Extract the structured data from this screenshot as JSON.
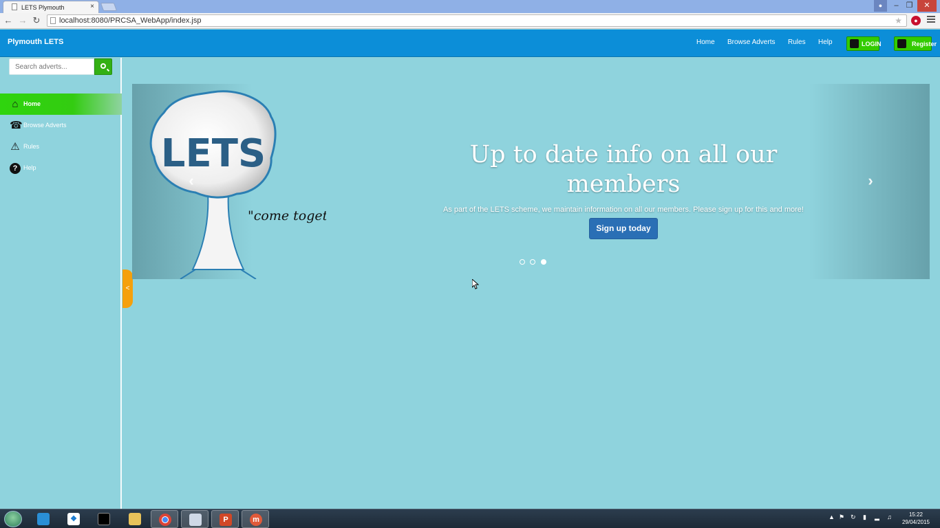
{
  "browser": {
    "tab_title": "LETS Plymouth",
    "tab_close": "×",
    "url": "localhost:8080/PRCSA_WebApp/index.jsp",
    "window_controls": {
      "minimize": "–",
      "maximize": "❐",
      "close": "✕"
    }
  },
  "navbar": {
    "brand": "Plymouth LETS",
    "links": [
      "Home",
      "Browse Adverts",
      "Rules",
      "Help"
    ],
    "login_label": "LOGIN",
    "register_label": "Register",
    "color": "#0c8ed8"
  },
  "search": {
    "placeholder": "Search adverts..."
  },
  "sidebar": {
    "items": [
      {
        "label": "Home",
        "icon": "home-icon",
        "active": true
      },
      {
        "label": "Browse Adverts",
        "icon": "headset-icon",
        "active": false
      },
      {
        "label": "Rules",
        "icon": "warning-icon",
        "active": false
      },
      {
        "label": "Help",
        "icon": "question-icon",
        "active": false
      }
    ],
    "collapse_label": "<",
    "active_color": "#33cc11"
  },
  "carousel": {
    "logo_text": "LETS",
    "logo_tagline": "\"come together\"",
    "heading": "Up to date info on all our members",
    "text": "As part of the LETS scheme, we maintain information on all our members. Please sign up for this and more!",
    "button_label": "Sign up today",
    "prev_label": "‹",
    "next_label": "›",
    "slide_count": 3,
    "active_slide": 3
  },
  "taskbar": {
    "apps": [
      "virtualbox-icon",
      "dropbox-icon",
      "cmd-icon",
      "explorer-icon",
      "chrome-icon",
      "app-icon",
      "powerpoint-icon",
      "m-app-icon"
    ],
    "time": "15:22",
    "date": "29/04/2015"
  },
  "colors": {
    "page_bg": "#8fd3dd",
    "signup_button": "#2a6fb5",
    "collapse_tab": "#f5a00c"
  }
}
